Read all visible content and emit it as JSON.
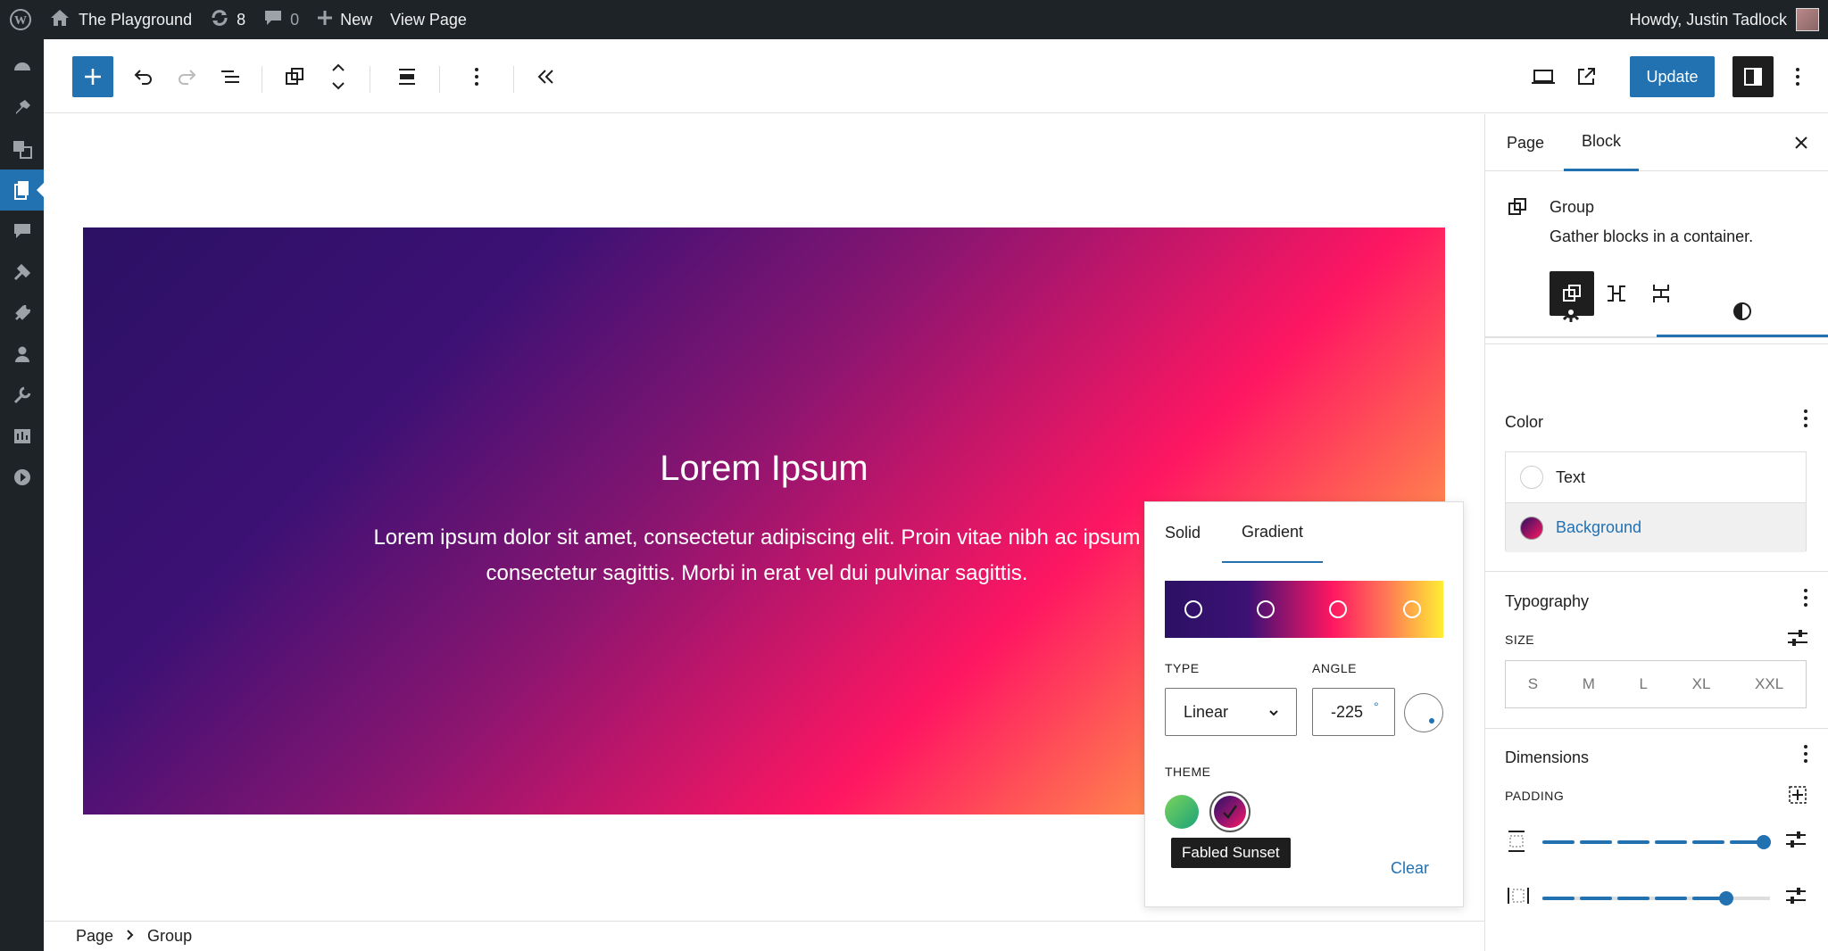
{
  "adminbar": {
    "site_name": "The Playground",
    "updates_count": "8",
    "comments_count": "0",
    "new_label": "New",
    "view_page_label": "View Page",
    "howdy": "Howdy, Justin Tadlock"
  },
  "admin_menu": {
    "items": [
      "dashboard-icon",
      "posts-icon",
      "media-icon",
      "pages-icon",
      "comments-icon",
      "appearance-icon",
      "plugins-icon",
      "users-icon",
      "tools-icon",
      "settings-icon",
      "collapse-icon"
    ]
  },
  "toolbar": {
    "update_label": "Update"
  },
  "content": {
    "heading": "Lorem Ipsum",
    "paragraph_line1": "Lorem ipsum dolor sit amet, consectetur adipiscing elit. Proin vitae nibh ac ipsum",
    "paragraph_line2": "consectetur sagittis. Morbi in erat vel dui pulvinar sagittis."
  },
  "breadcrumb": {
    "items": [
      "Page",
      "Group"
    ]
  },
  "sidebar": {
    "tabs": [
      "Page",
      "Block"
    ],
    "active_tab": "Block",
    "block": {
      "title": "Group",
      "description": "Gather blocks in a container."
    },
    "color_panel": {
      "title": "Color",
      "items": [
        {
          "label": "Text",
          "swatch": "#ffffff"
        },
        {
          "label": "Background",
          "swatch": "linear-gradient(135deg,#2b1164,#ff1662)"
        }
      ]
    },
    "typography": {
      "title": "Typography",
      "size_label": "SIZE",
      "sizes": [
        "S",
        "M",
        "L",
        "XL",
        "XXL"
      ]
    },
    "dimensions": {
      "title": "Dimensions",
      "padding_label": "PADDING",
      "vertical_padding_level": 1.0,
      "horizontal_padding_level": 0.85
    }
  },
  "popover": {
    "tabs": [
      "Solid",
      "Gradient"
    ],
    "active_tab": "Gradient",
    "type_label": "TYPE",
    "type_value": "Linear",
    "angle_label": "ANGLE",
    "angle_value": "-225",
    "angle_unit": "°",
    "theme_label": "THEME",
    "theme_swatches": [
      {
        "name": "green-gradient",
        "color": "#4caf50"
      },
      {
        "name": "Fabled Sunset",
        "color": "#7b1a6e",
        "selected": true
      }
    ],
    "tooltip": "Fabled Sunset",
    "clear_label": "Clear"
  },
  "colors": {
    "accent": "#2271b1",
    "admin_bar": "#1d2327"
  }
}
